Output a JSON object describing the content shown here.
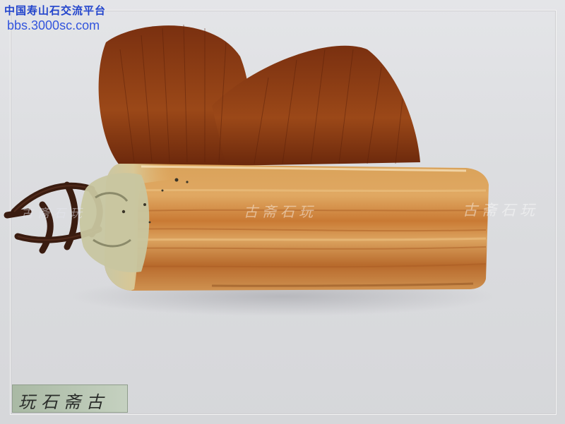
{
  "watermarks": {
    "site_name": "中国寿山石交流平台",
    "site_url": "bbs.3000sc.com",
    "seal_center": "古斋石玩",
    "seal_right": "古斋石玩",
    "seal_left": "古斋石玩"
  },
  "logo": {
    "text": "玩石斋古"
  },
  "colors": {
    "tassel": "#8a3a10",
    "stone_amber": "#c87a30",
    "stone_jade": "#c9c7a4",
    "cord": "#3a1c10",
    "watermark_blue": "#2244cc"
  },
  "subject": {
    "icon": "seal-stone-icon"
  }
}
